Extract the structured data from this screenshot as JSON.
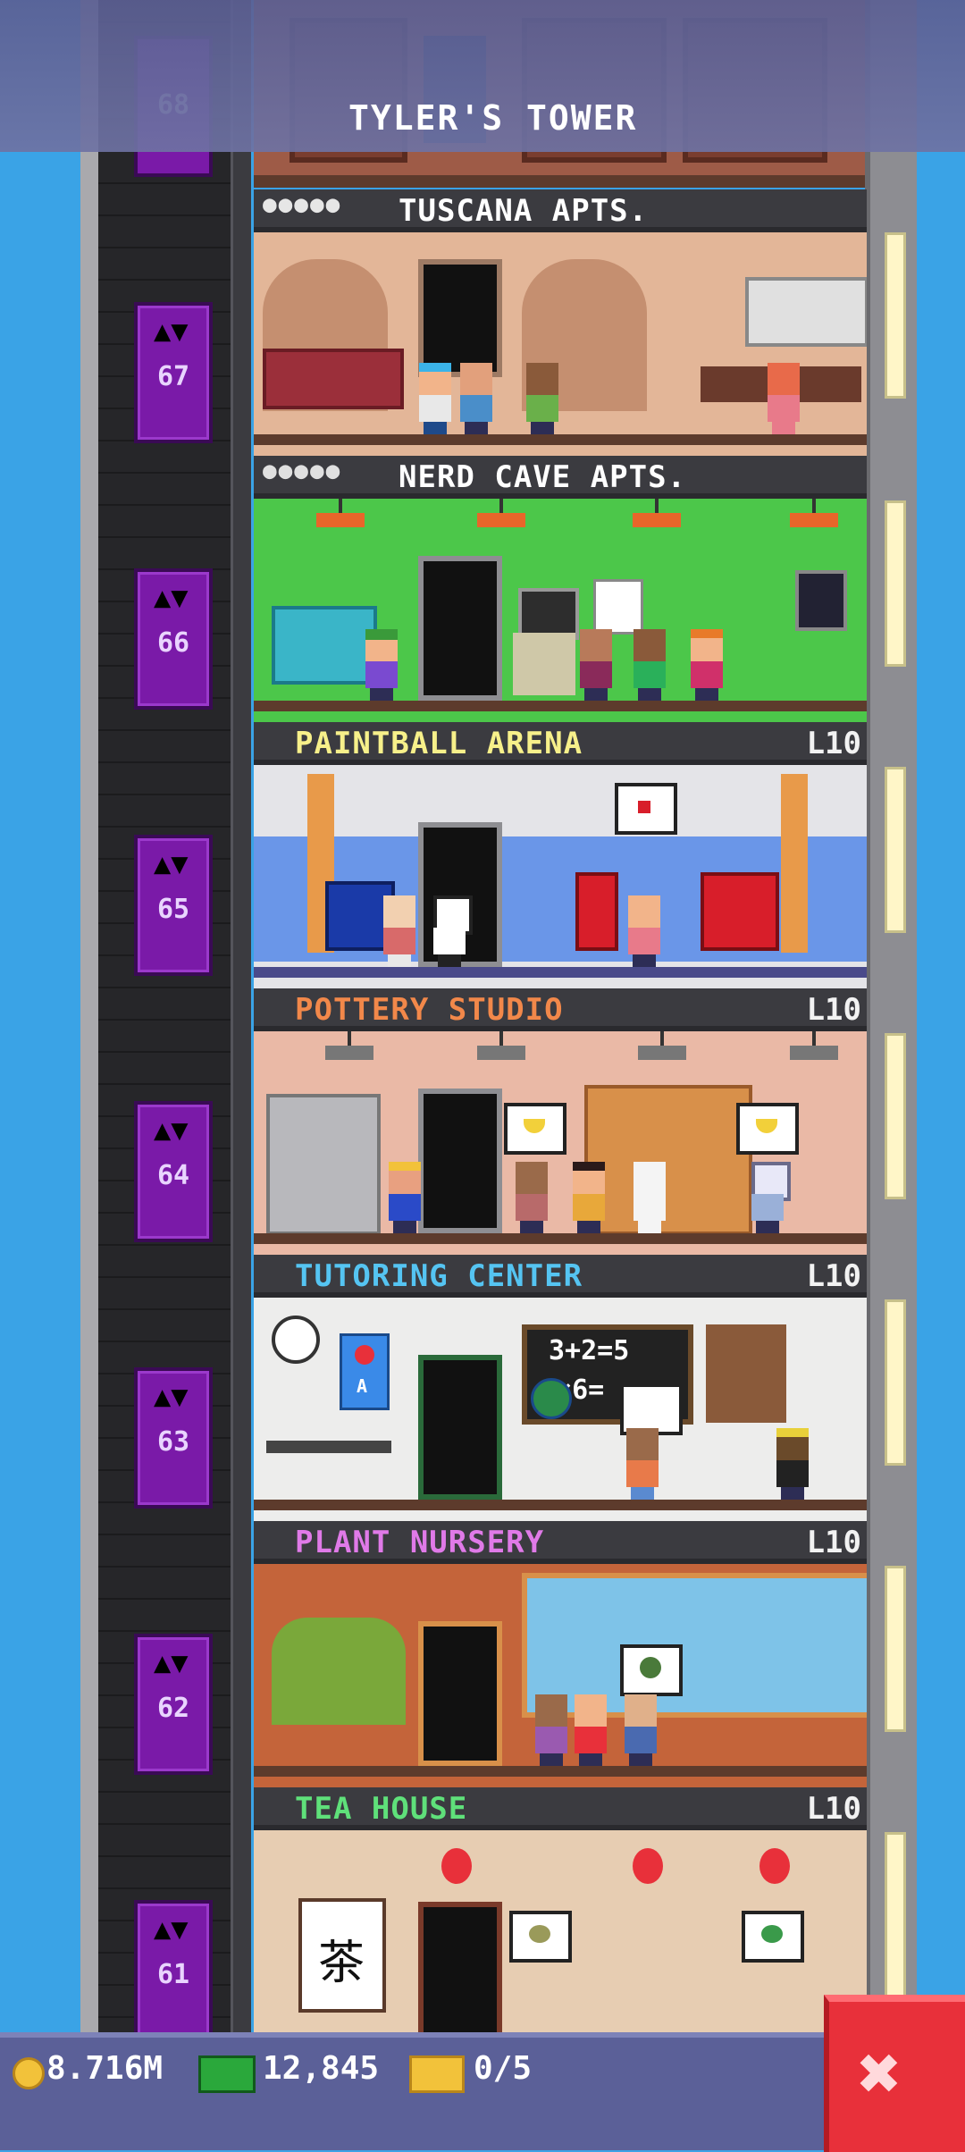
{
  "header": {
    "title": "TYLER'S TOWER"
  },
  "top_floor": {
    "number": "68"
  },
  "floors": [
    {
      "number": "67",
      "name": "TUSCANA APTS.",
      "residents": "●●●●●",
      "level": "",
      "name_color": "#ffffff",
      "theme": "tuscana"
    },
    {
      "number": "66",
      "name": "NERD CAVE APTS.",
      "residents": "●●●●●",
      "level": "",
      "name_color": "#ffffff",
      "theme": "nerd"
    },
    {
      "number": "65",
      "name": "PAINTBALL ARENA",
      "residents": "",
      "level": "L10",
      "name_color": "#f7f08a",
      "theme": "paintball"
    },
    {
      "number": "64",
      "name": "POTTERY STUDIO",
      "residents": "",
      "level": "L10",
      "name_color": "#f2884a",
      "theme": "pottery"
    },
    {
      "number": "63",
      "name": "TUTORING CENTER",
      "residents": "",
      "level": "L10",
      "name_color": "#55c4f2",
      "theme": "tutoring"
    },
    {
      "number": "62",
      "name": "PLANT NURSERY",
      "residents": "",
      "level": "L10",
      "name_color": "#e07ae8",
      "theme": "plant"
    },
    {
      "number": "61",
      "name": "TEA HOUSE",
      "residents": "",
      "level": "L10",
      "name_color": "#5fe07a",
      "theme": "tea"
    }
  ],
  "chalkboard": {
    "line1": "3+2=5",
    "line2": "6×6="
  },
  "tea_scroll": "茶",
  "poster_letter": "A",
  "status_bar": {
    "coins": "8.716M",
    "bux": "12,845",
    "tickets": "0/5"
  },
  "close_symbol": "✖",
  "icons": {
    "coin": "coin-icon",
    "bux": "bux-icon",
    "ticket": "ticket-icon",
    "elevator": "bat-icon",
    "close": "close-icon"
  }
}
